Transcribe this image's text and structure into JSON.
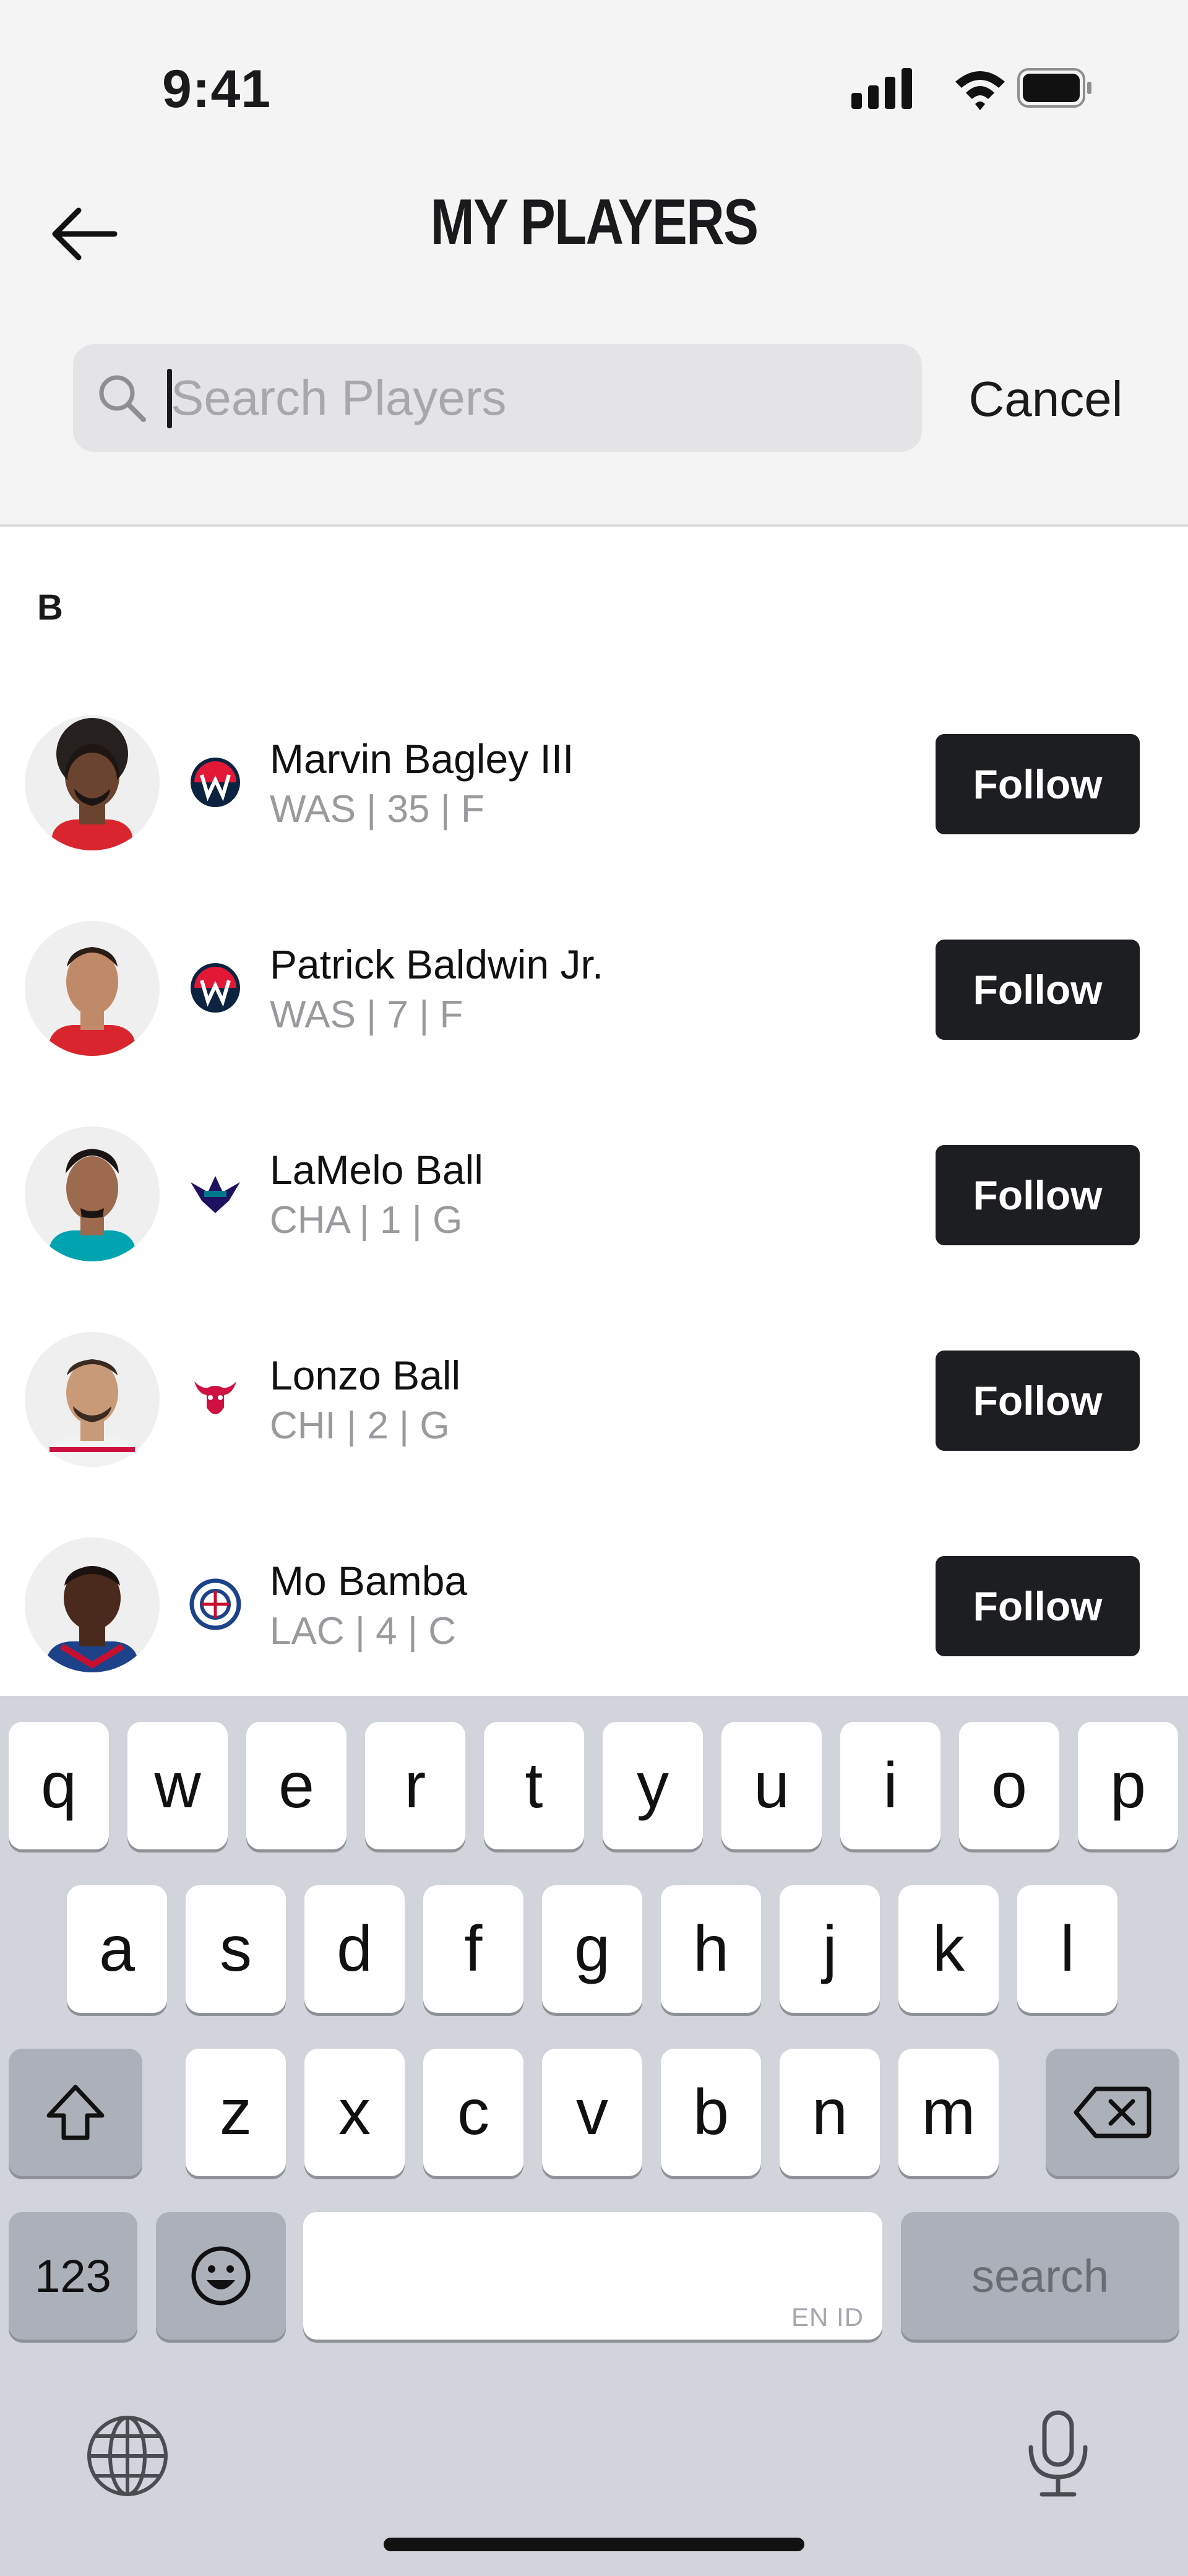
{
  "status_bar": {
    "time": "9:41",
    "icons": [
      "signal-icon",
      "wifi-icon",
      "battery-icon"
    ]
  },
  "header": {
    "title": "MY PLAYERS",
    "back_icon": "arrow-left-icon"
  },
  "search": {
    "placeholder": "Search Players",
    "value": "",
    "cancel_label": "Cancel"
  },
  "section": {
    "letter": "B"
  },
  "players": [
    {
      "name": "Marvin Bagley III",
      "meta": "WAS | 35 | F",
      "team": "WAS",
      "follow_label": "Follow"
    },
    {
      "name": "Patrick Baldwin Jr.",
      "meta": "WAS | 7 | F",
      "team": "WAS",
      "follow_label": "Follow"
    },
    {
      "name": "LaMelo Ball",
      "meta": "CHA | 1 | G",
      "team": "CHA",
      "follow_label": "Follow"
    },
    {
      "name": "Lonzo Ball",
      "meta": "CHI | 2 | G",
      "team": "CHI",
      "follow_label": "Follow"
    },
    {
      "name": "Mo Bamba",
      "meta": "LAC | 4 | C",
      "team": "LAC",
      "follow_label": "Follow"
    }
  ],
  "keyboard": {
    "row1": [
      "q",
      "w",
      "e",
      "r",
      "t",
      "y",
      "u",
      "i",
      "o",
      "p"
    ],
    "row2": [
      "a",
      "s",
      "d",
      "f",
      "g",
      "h",
      "j",
      "k",
      "l"
    ],
    "row3": [
      "z",
      "x",
      "c",
      "v",
      "b",
      "n",
      "m"
    ],
    "numbers_label": "123",
    "space_lang_label": "EN ID",
    "return_label": "search"
  },
  "colors": {
    "follow_bg": "#1c1e22",
    "top_bg": "#f4f4f4",
    "keyboard_bg": "#d1d4da"
  }
}
